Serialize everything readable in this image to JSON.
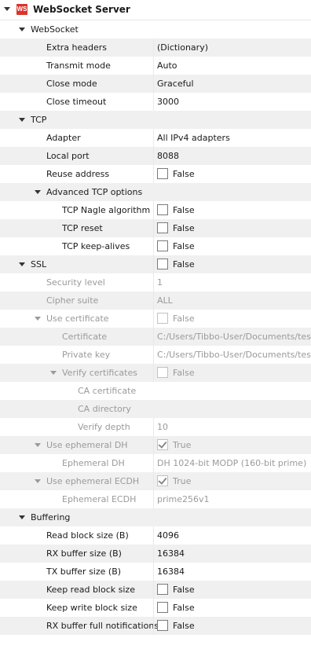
{
  "root": {
    "title": "WebSocket Server",
    "logo_text": "WS",
    "logo_color": "#d9342b"
  },
  "groups": {
    "websocket": {
      "label": "WebSocket"
    },
    "tcp": {
      "label": "TCP"
    },
    "advanced_tcp": {
      "label": "Advanced TCP options"
    },
    "ssl": {
      "label": "SSL",
      "value": "False"
    },
    "use_certificate": {
      "label": "Use certificate",
      "value": "False"
    },
    "verify_certificates": {
      "label": "Verify certificates",
      "value": "False"
    },
    "use_ephemeral_dh": {
      "label": "Use ephemeral DH",
      "value": "True"
    },
    "use_ephemeral_ecdh": {
      "label": "Use ephemeral ECDH",
      "value": "True"
    },
    "buffering": {
      "label": "Buffering"
    }
  },
  "props": {
    "extra_headers": {
      "label": "Extra headers",
      "value": "(Dictionary)"
    },
    "transmit_mode": {
      "label": "Transmit mode",
      "value": "Auto"
    },
    "close_mode": {
      "label": "Close mode",
      "value": "Graceful"
    },
    "close_timeout": {
      "label": "Close timeout",
      "value": "3000"
    },
    "adapter": {
      "label": "Adapter",
      "value": "All IPv4 adapters"
    },
    "local_port": {
      "label": "Local port",
      "value": "8088"
    },
    "reuse_address": {
      "label": "Reuse address",
      "value": "False"
    },
    "tcp_nagle": {
      "label": "TCP Nagle algorithm",
      "value": "False"
    },
    "tcp_reset": {
      "label": "TCP reset",
      "value": "False"
    },
    "tcp_keepalives": {
      "label": "TCP keep-alives",
      "value": "False"
    },
    "security_level": {
      "label": "Security level",
      "value": "1"
    },
    "cipher_suite": {
      "label": "Cipher suite",
      "value": "ALL"
    },
    "certificate": {
      "label": "Certificate",
      "value": "C:/Users/Tibbo-User/Documents/test-ce..."
    },
    "private_key": {
      "label": "Private key",
      "value": "C:/Users/Tibbo-User/Documents/test-ce..."
    },
    "ca_certificate": {
      "label": "CA certificate",
      "value": ""
    },
    "ca_directory": {
      "label": "CA directory",
      "value": ""
    },
    "verify_depth": {
      "label": "Verify depth",
      "value": "10"
    },
    "ephemeral_dh": {
      "label": "Ephemeral DH",
      "value": "DH 1024-bit MODP (160-bit prime)"
    },
    "ephemeral_ecdh": {
      "label": "Ephemeral ECDH",
      "value": "prime256v1"
    },
    "read_block_size": {
      "label": "Read block size (B)",
      "value": "4096"
    },
    "rx_buffer_size": {
      "label": "RX buffer size (B)",
      "value": "16384"
    },
    "tx_buffer_size": {
      "label": "TX buffer size (B)",
      "value": "16384"
    },
    "keep_read_block_size": {
      "label": "Keep read block size",
      "value": "False"
    },
    "keep_write_block_size": {
      "label": "Keep write block size",
      "value": "False"
    },
    "rx_buffer_full_notifications": {
      "label": "RX buffer full notifications",
      "value": "False"
    }
  }
}
